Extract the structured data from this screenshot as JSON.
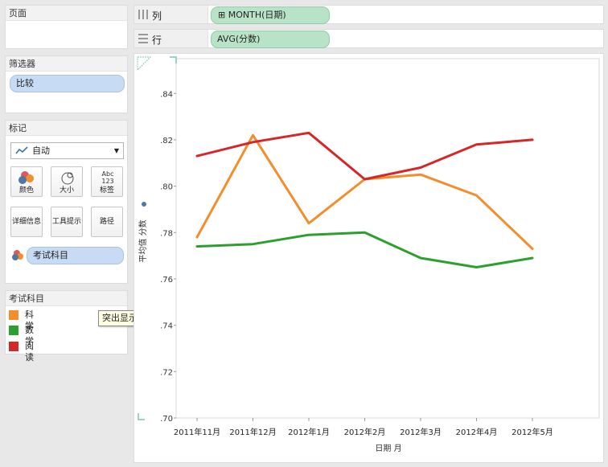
{
  "pages_card": {
    "title": "页面"
  },
  "filters_card": {
    "title": "筛选器",
    "pill": "比较"
  },
  "marks_card": {
    "title": "标记",
    "mark_type": "自动",
    "buttons": {
      "color": "颜色",
      "size": "大小",
      "label": "标签",
      "detail": "详细信息",
      "tooltip": "工具提示",
      "path": "路径"
    },
    "label_icon_text": "Abc\n123",
    "field_pill": "考试科目"
  },
  "legend": {
    "title": "考试科目",
    "items": [
      {
        "label": "科学",
        "color": "#f28e2b"
      },
      {
        "label": "数学",
        "color": "#2ca02c"
      },
      {
        "label": "阅读",
        "color": "#d62728"
      }
    ]
  },
  "tooltip": {
    "text": "突出显示选定项"
  },
  "shelves": {
    "columns": {
      "label": "列",
      "pill": "MONTH(日期)",
      "expand_icon": "⊞"
    },
    "rows": {
      "label": "行",
      "pill": "AVG(分数)"
    }
  },
  "chart_data": {
    "type": "line",
    "categories": [
      "2011年11月",
      "2011年12月",
      "2012年1月",
      "2012年2月",
      "2012年3月",
      "2012年4月",
      "2012年5月"
    ],
    "series": [
      {
        "name": "科学",
        "color": "#f28e2b",
        "values": [
          0.778,
          0.822,
          0.784,
          0.803,
          0.805,
          0.796,
          0.773
        ]
      },
      {
        "name": "数学",
        "color": "#2ca02c",
        "values": [
          0.774,
          0.775,
          0.779,
          0.78,
          0.769,
          0.765,
          0.769
        ]
      },
      {
        "name": "阅读",
        "color": "#d62728",
        "values": [
          0.813,
          0.819,
          0.823,
          0.803,
          0.808,
          0.818,
          0.82
        ]
      }
    ],
    "yticks": [
      ".70",
      ".72",
      ".74",
      ".76",
      ".78",
      ".80",
      ".82",
      ".84"
    ],
    "ylim": [
      0.7,
      0.855
    ],
    "xlabel": "日期 月",
    "ylabel": "平均值 分数",
    "grid": false
  }
}
